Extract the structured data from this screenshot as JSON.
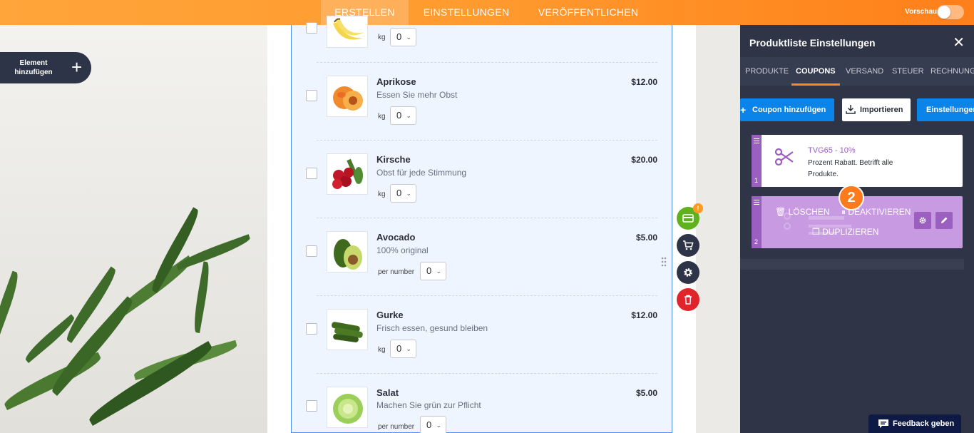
{
  "topbar": {
    "tabs": [
      {
        "label": "ERSTELLEN"
      },
      {
        "label": "EINSTELLUNGEN"
      },
      {
        "label": "VERÖFFENTLICHEN"
      }
    ],
    "preview_label": "Vorschau"
  },
  "add_element": {
    "label": "Element hinzufügen"
  },
  "products": [
    {
      "name": "",
      "desc": "",
      "unit": "kg",
      "qty": "0",
      "price": ""
    },
    {
      "name": "Aprikose",
      "desc": "Essen Sie mehr Obst",
      "unit": "kg",
      "qty": "0",
      "price": "$12.00"
    },
    {
      "name": "Kirsche",
      "desc": "Obst für jede Stimmung",
      "unit": "kg",
      "qty": "0",
      "price": "$20.00"
    },
    {
      "name": "Avocado",
      "desc": "100% original",
      "unit": "per number",
      "qty": "0",
      "price": "$5.00"
    },
    {
      "name": "Gurke",
      "desc": "Frisch essen, gesund bleiben",
      "unit": "kg",
      "qty": "0",
      "price": "$12.00"
    },
    {
      "name": "Salat",
      "desc": "Machen Sie grün zur Pflicht",
      "unit": "per number",
      "qty": "0",
      "price": "$5.00"
    }
  ],
  "tools": {
    "badge": "!"
  },
  "panel": {
    "title": "Produktliste Einstellungen",
    "tabs": [
      {
        "label": "PRODUKTE"
      },
      {
        "label": "COUPONS"
      },
      {
        "label": "VERSAND"
      },
      {
        "label": "STEUER"
      },
      {
        "label": "RECHNUNG"
      }
    ],
    "buttons": {
      "add_coupon": "Coupon hinzufügen",
      "import": "Importieren",
      "settings": "Einstellungen"
    },
    "coupons": [
      {
        "number": "1",
        "name": "TVG65 - 10%",
        "desc": "Prozent Rabatt. Betrifft alle Produkte."
      },
      {
        "number": "2"
      }
    ],
    "actions": {
      "delete": "LÖSCHEN",
      "deactivate": "DEAKTIVIEREN",
      "duplicate": "DUPLIZIEREN"
    },
    "step": "2"
  },
  "feedback": {
    "label": "Feedback geben"
  },
  "colors": {
    "accent": "#ff8a1f",
    "panel": "#2f3546",
    "coupon": "#9b5fc0",
    "blue": "#0a84e8"
  }
}
